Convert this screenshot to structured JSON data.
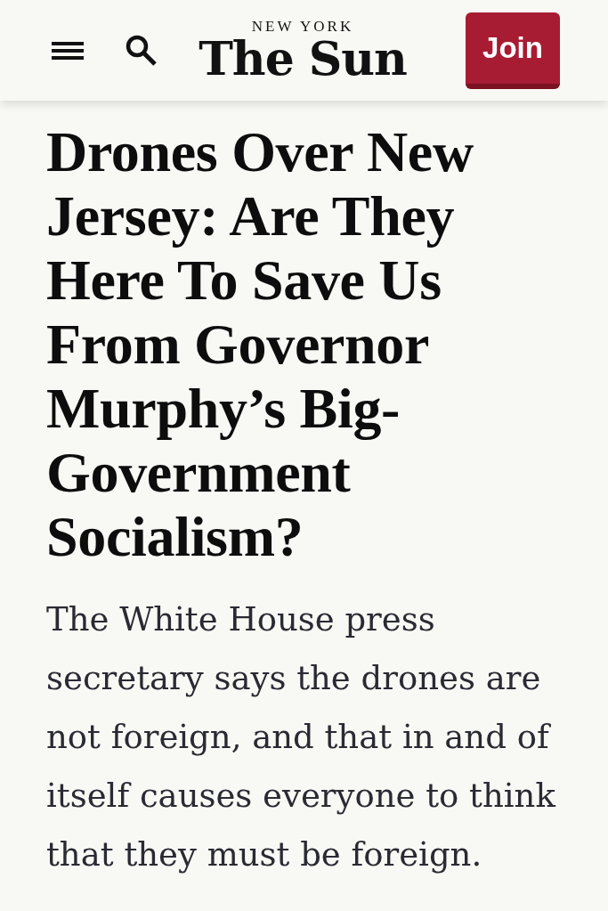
{
  "header": {
    "logo": {
      "overline": "NEW YORK",
      "wordmark": "The Sun"
    },
    "join_button": "Join"
  },
  "article": {
    "headline": "Drones Over New Jersey: Are They Here To Save Us From Governor Murphy’s Big-Government Socialism?",
    "dek": "The White House press secretary says the drones are not foreign, and that in and of itself causes everyone to think that they must be foreign."
  }
}
